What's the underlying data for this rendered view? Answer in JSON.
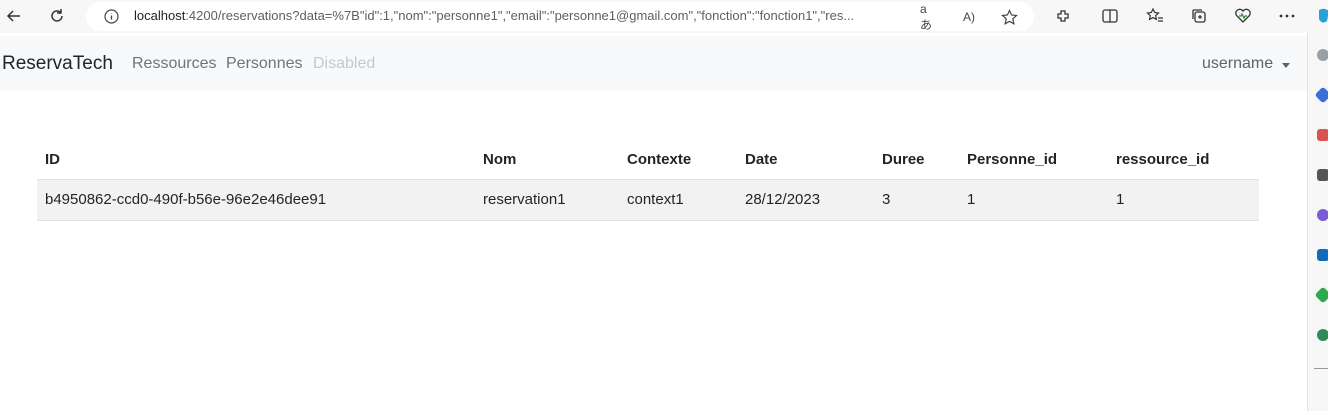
{
  "browser": {
    "url_host": "localhost",
    "url_rest": ":4200/reservations?data=%7B\"id\":1,\"nom\":\"personne1\",\"email\":\"personne1@gmail.com\",\"fonction\":\"fonction1\",\"res..."
  },
  "navbar": {
    "brand": "ReservaTech",
    "links": [
      {
        "label": "Ressources"
      },
      {
        "label": "Personnes"
      },
      {
        "label": "Disabled"
      }
    ],
    "user": "username"
  },
  "table": {
    "headers": [
      "ID",
      "Nom",
      "Contexte",
      "Date",
      "Duree",
      "Personne_id",
      "ressource_id"
    ],
    "rows": [
      [
        "b4950862-ccd0-490f-b56e-96e2e46dee91",
        "reservation1",
        "context1",
        "28/12/2023",
        "3",
        "1",
        "1"
      ]
    ]
  },
  "colors": {
    "navbar_bg": "#f8f9fa",
    "row_bg": "#f2f2f2",
    "link": "#6c757d",
    "disabled_link": "#c5c8cc"
  }
}
